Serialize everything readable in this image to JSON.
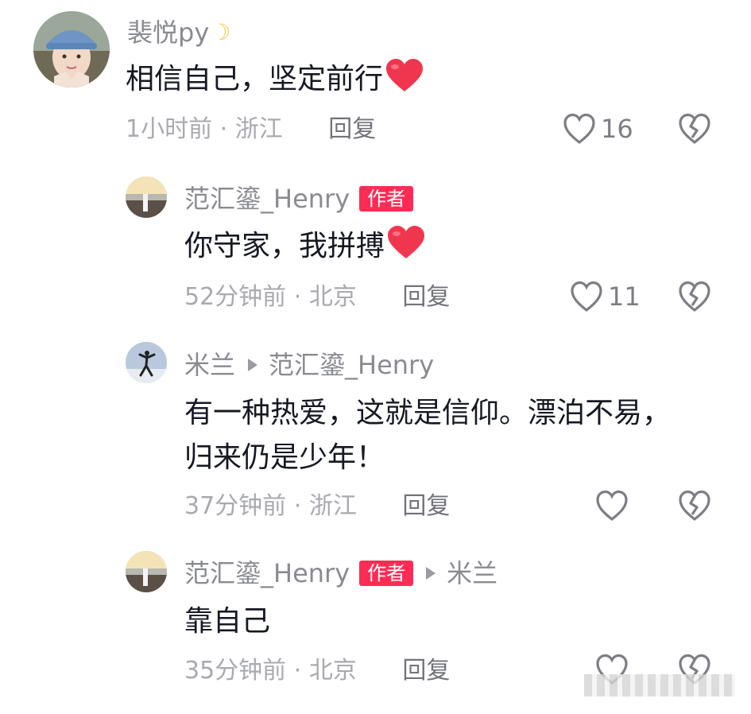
{
  "comments": [
    {
      "user": "裴悦py",
      "text": "相信自己，坚定前行",
      "time": "1小时前",
      "location": "浙江",
      "reply_label": "回复",
      "like_count": "16"
    },
    {
      "user": "范汇鎏_Henry",
      "author_badge": "作者",
      "text": "你守家，我拼搏",
      "time": "52分钟前",
      "location": "北京",
      "reply_label": "回复",
      "like_count": "11"
    },
    {
      "user": "米兰",
      "reply_to": "范汇鎏_Henry",
      "text_line1": "有一种热爱，这就是信仰。漂泊不易，",
      "text_line2": "归来仍是少年！",
      "time": "37分钟前",
      "location": "浙江",
      "reply_label": "回复"
    },
    {
      "user": "范汇鎏_Henry",
      "author_badge": "作者",
      "reply_to": "米兰",
      "text": "靠自己",
      "time": "35分钟前",
      "location": "北京",
      "reply_label": "回复"
    }
  ],
  "separator": "·",
  "icons": {
    "like": "heart-outline-icon",
    "dislike": "broken-heart-icon",
    "emoji": "red-heart-emoji",
    "moon": "crescent-moon-emoji"
  },
  "colors": {
    "author_badge_bg": "#fe2c55",
    "emoji_heart": "#f0364f",
    "username": "#8a8b91"
  }
}
